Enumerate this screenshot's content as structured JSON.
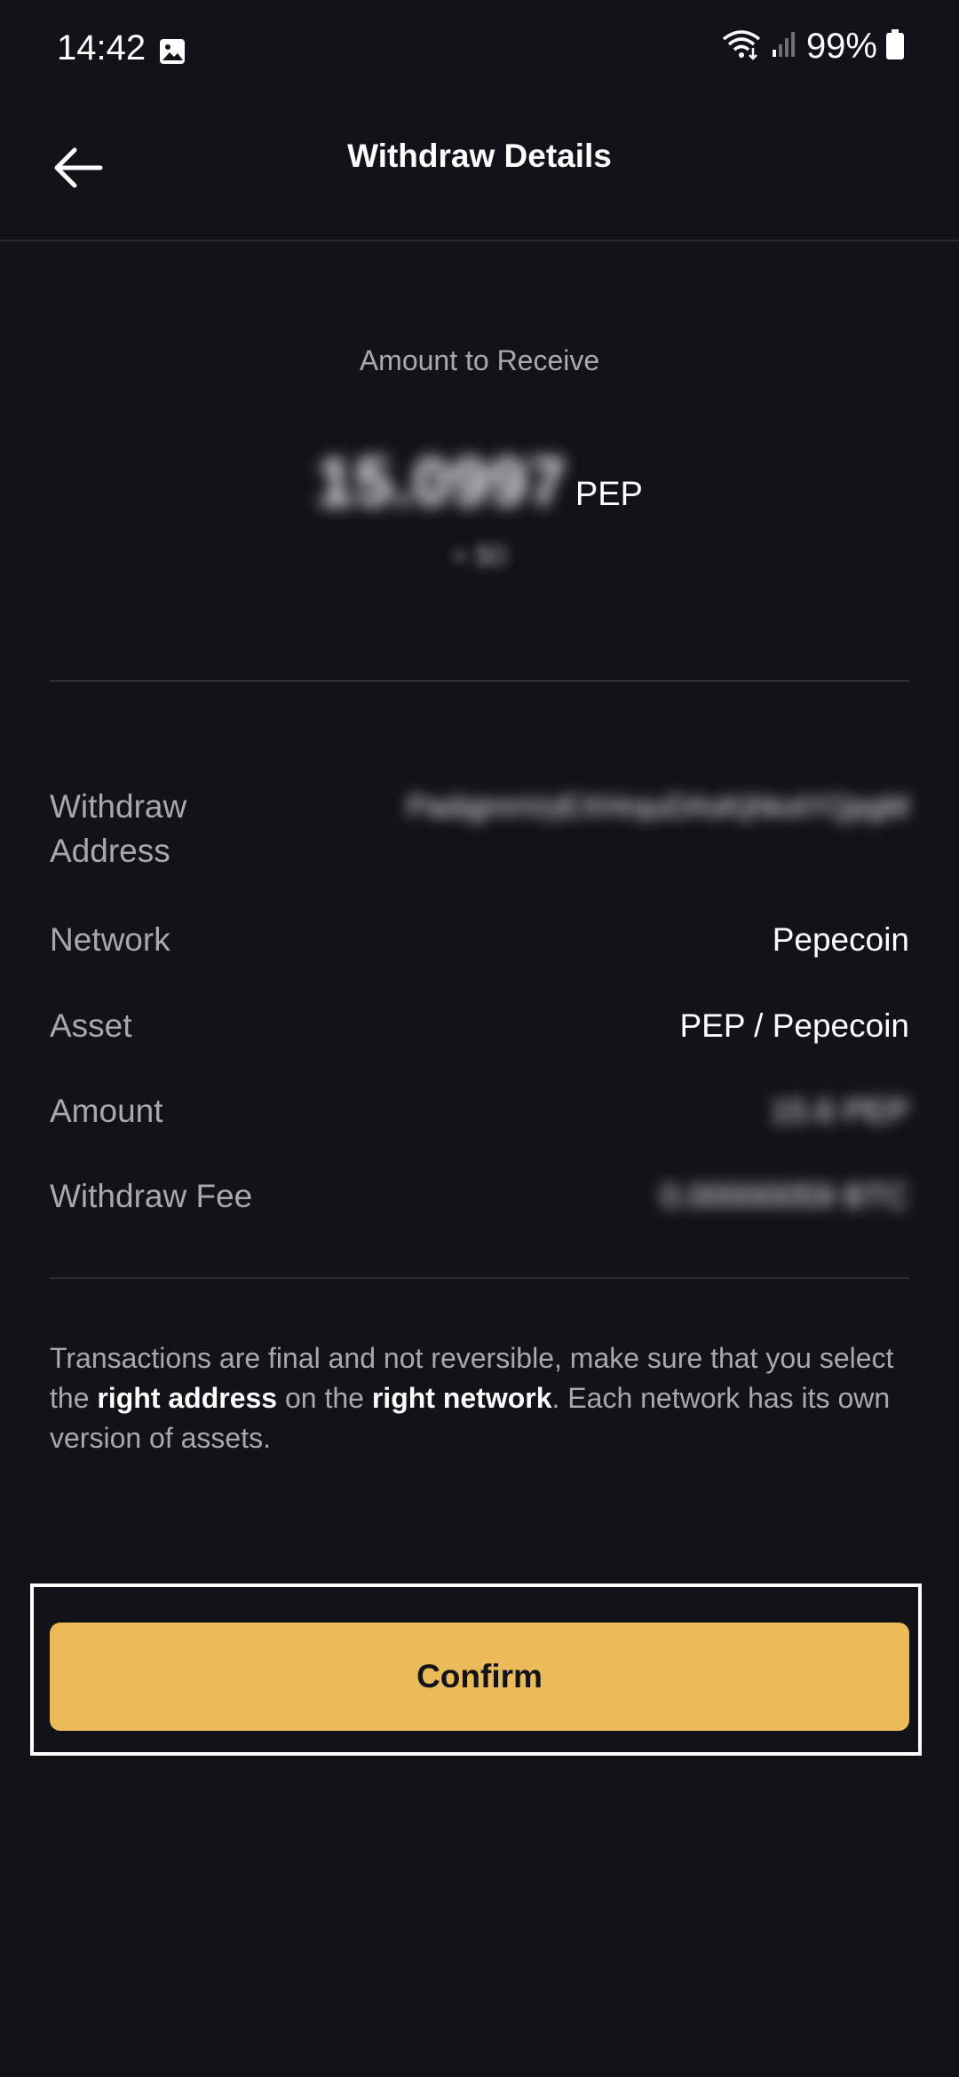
{
  "status_bar": {
    "time": "14:42",
    "battery": "99%"
  },
  "header": {
    "title": "Withdraw Details"
  },
  "amount": {
    "label": "Amount to Receive",
    "value": "15.0997",
    "unit": "PEP",
    "fiat": "≈ $0"
  },
  "details": {
    "address_label": "Withdraw Address",
    "address_value": "PadqjmnVyEXHrquDAsKjhkotYQpgM",
    "network_label": "Network",
    "network_value": "Pepecoin",
    "asset_label": "Asset",
    "asset_value": "PEP / Pepecoin",
    "amount_label": "Amount",
    "amount_value": "15.6 PEP",
    "fee_label": "Withdraw Fee",
    "fee_value": "0.00000059 BTC"
  },
  "notice": {
    "part1": "Transactions are final and not reversible, make sure that you select the ",
    "bold1": "right address",
    "part2": " on the ",
    "bold2": "right network",
    "part3": ". Each network has its own version of assets."
  },
  "confirm": {
    "label": "Confirm"
  },
  "icons": {
    "back": "arrow-left-icon",
    "gallery": "image-icon",
    "wifi": "wifi-icon",
    "signal": "signal-icon",
    "battery": "battery-icon"
  },
  "colors": {
    "background": "#131218",
    "accent": "#ebbb5a",
    "muted_text": "#a9a8ae"
  }
}
